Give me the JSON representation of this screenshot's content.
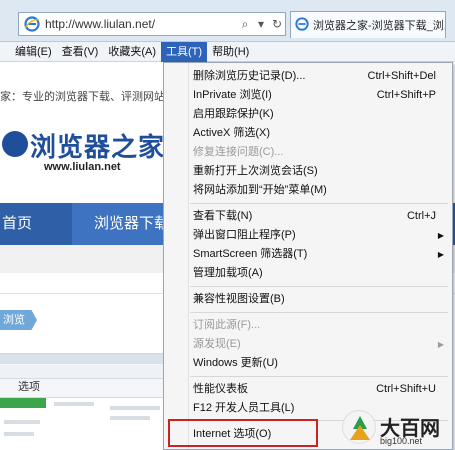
{
  "address_bar": {
    "url": "http://www.liulan.net/",
    "search_glyph": "⌕",
    "dropdown_glyph": "▾",
    "refresh_glyph": "↻",
    "tab_title": "浏览器之家-浏览器下载_浏...",
    "icon": "ie-icon"
  },
  "menu_bar": {
    "items": [
      {
        "id": "file",
        "label": ""
      },
      {
        "id": "edit",
        "label": "编辑(E)"
      },
      {
        "id": "view",
        "label": "查看(V)"
      },
      {
        "id": "favorites",
        "label": "收藏夹(A)"
      },
      {
        "id": "tools",
        "label": "工具(T)"
      },
      {
        "id": "help",
        "label": "帮助(H)"
      }
    ],
    "active": "tools",
    "active_color": "#2d63b8"
  },
  "page": {
    "tagline": "家：专业的浏览器下载、评测网站",
    "logo_title": "浏览器之家",
    "logo_url": "www.liulan.net",
    "nav_home": "首页",
    "nav_browser": "浏览器下载",
    "tag_button": "浏览",
    "nav_color": "#2f5fa7"
  },
  "embedded": {
    "title": "选项"
  },
  "tools_menu": {
    "items": [
      {
        "label": "删除浏览历史记录(D)...",
        "shortcut": "Ctrl+Shift+Del",
        "enabled": true
      },
      {
        "label": "InPrivate 浏览(I)",
        "shortcut": "Ctrl+Shift+P",
        "enabled": true
      },
      {
        "label": "启用跟踪保护(K)",
        "shortcut": "",
        "enabled": true
      },
      {
        "label": "ActiveX 筛选(X)",
        "shortcut": "",
        "enabled": true
      },
      {
        "label": "修复连接问题(C)...",
        "shortcut": "",
        "enabled": false
      },
      {
        "label": "重新打开上次浏览会话(S)",
        "shortcut": "",
        "enabled": true
      },
      {
        "label": "将网站添加到“开始”菜单(M)",
        "shortcut": "",
        "enabled": true
      },
      {
        "label": "查看下载(N)",
        "shortcut": "Ctrl+J",
        "enabled": true
      },
      {
        "label": "弹出窗口阻止程序(P)",
        "shortcut": "",
        "enabled": true,
        "submenu": true
      },
      {
        "label": "SmartScreen 筛选器(T)",
        "shortcut": "",
        "enabled": true,
        "submenu": true
      },
      {
        "label": "管理加载项(A)",
        "shortcut": "",
        "enabled": true
      },
      {
        "label": "兼容性视图设置(B)",
        "shortcut": "",
        "enabled": true
      },
      {
        "label": "订阅此源(F)...",
        "shortcut": "",
        "enabled": false
      },
      {
        "label": "源发现(E)",
        "shortcut": "",
        "enabled": false,
        "submenu": true
      },
      {
        "label": "Windows 更新(U)",
        "shortcut": "",
        "enabled": true
      },
      {
        "label": "性能仪表板",
        "shortcut": "Ctrl+Shift+U",
        "enabled": true
      },
      {
        "label": "F12 开发人员工具(L)",
        "shortcut": "",
        "enabled": true
      },
      {
        "label": "Internet 选项(O)",
        "shortcut": "",
        "enabled": true,
        "highlighted": true
      }
    ],
    "highlight_color": "#cc2222",
    "submenu_arrow": "▶"
  },
  "watermark": {
    "text": "大百网",
    "sub": "big100.net"
  }
}
